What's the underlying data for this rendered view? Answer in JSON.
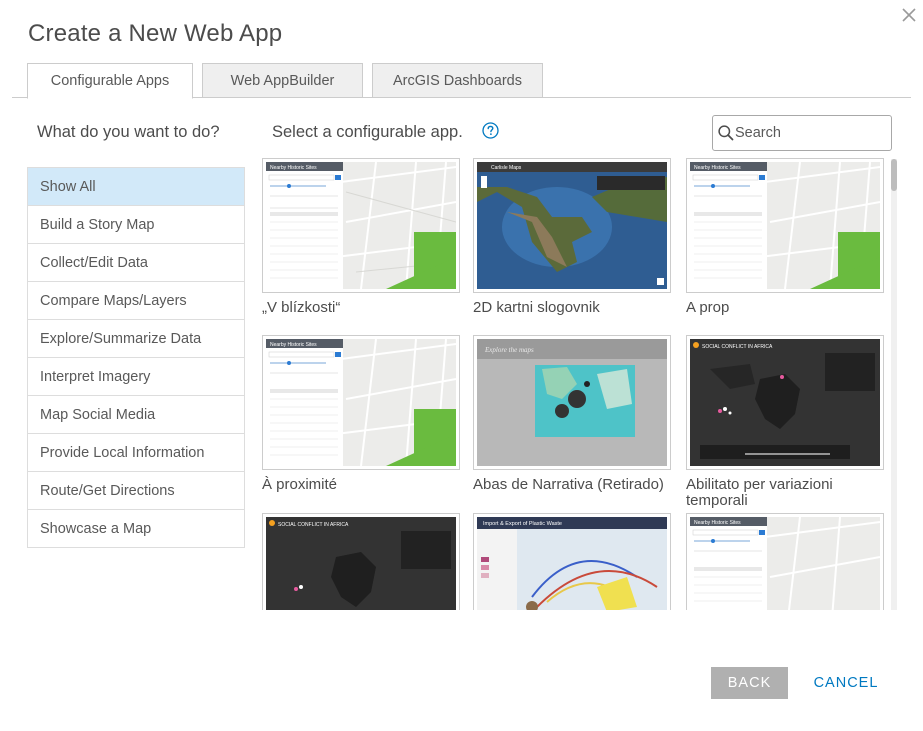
{
  "dialog": {
    "title": "Create a New Web App",
    "close_icon": "close-icon"
  },
  "tabs": [
    {
      "label": "Configurable Apps",
      "active": true
    },
    {
      "label": "Web AppBuilder",
      "active": false
    },
    {
      "label": "ArcGIS Dashboards",
      "active": false
    }
  ],
  "sidebar": {
    "question": "What do you want to do?",
    "items": [
      {
        "label": "Show All",
        "active": true
      },
      {
        "label": "Build a Story Map"
      },
      {
        "label": "Collect/Edit Data"
      },
      {
        "label": "Compare Maps/Layers"
      },
      {
        "label": "Explore/Summarize Data"
      },
      {
        "label": "Interpret Imagery"
      },
      {
        "label": "Map Social Media"
      },
      {
        "label": "Provide Local Information"
      },
      {
        "label": "Route/Get Directions"
      },
      {
        "label": "Showcase a Map"
      }
    ]
  },
  "main": {
    "select_label": "Select a configurable app.",
    "help_icon": "question-circle-icon",
    "search": {
      "placeholder": "Search",
      "value": "",
      "icon": "search-icon"
    }
  },
  "apps": [
    {
      "title": "„V blízkosti“",
      "thumb": "Nearby Historic Sites"
    },
    {
      "title": "2D kartni slogovnik",
      "thumb": "Carlisle Maps"
    },
    {
      "title": "A prop",
      "thumb": "Nearby Historic Sites"
    },
    {
      "title": "À proximité",
      "thumb": "Nearby Historic Sites"
    },
    {
      "title": "Abas de Narrativa (Retirado)",
      "thumb": "Explore the maps"
    },
    {
      "title": "Abilitato per variazioni temporali",
      "thumb": "SOCIAL CONFLICT IN AFRICA"
    },
    {
      "title": "",
      "thumb": "SOCIAL CONFLICT IN AFRICA"
    },
    {
      "title": "",
      "thumb": "Import & Export of Plastic Waste"
    },
    {
      "title": "",
      "thumb": "Nearby Historic Sites"
    }
  ],
  "footer": {
    "back_label": "BACK",
    "cancel_label": "CANCEL"
  },
  "colors": {
    "accent": "#0079c1",
    "active_item": "#d2e9f9",
    "back_button": "#b0b0b0"
  }
}
